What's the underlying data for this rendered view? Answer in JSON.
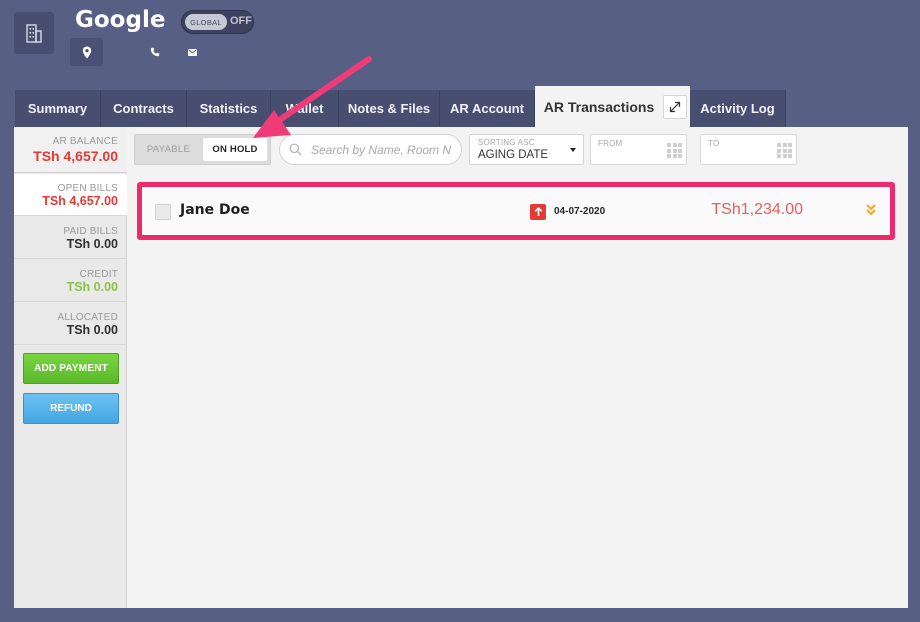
{
  "header": {
    "company_name": "Google",
    "global_toggle": {
      "label": "GLOBAL",
      "state": "OFF"
    }
  },
  "tabs": [
    {
      "label": "Summary"
    },
    {
      "label": "Contracts"
    },
    {
      "label": "Statistics"
    },
    {
      "label": "Wallet"
    },
    {
      "label": "Notes & Files"
    },
    {
      "label": "AR Account"
    },
    {
      "label": "AR Transactions",
      "active": true
    },
    {
      "label": "Activity Log"
    }
  ],
  "sidebar": {
    "ar_balance": {
      "label": "AR BALANCE",
      "value": "TSh 4,657.00"
    },
    "open_bills": {
      "label": "OPEN BILLS",
      "value": "TSh 4,657.00"
    },
    "paid_bills": {
      "label": "PAID BILLS",
      "value": "TSh 0.00"
    },
    "credit": {
      "label": "CREDIT",
      "value": "TSh 0.00"
    },
    "allocated": {
      "label": "ALLOCATED",
      "value": "TSh 0.00"
    },
    "add_payment_label": "ADD PAYMENT",
    "refund_label": "REFUND"
  },
  "filters": {
    "payable_label": "PAYABLE",
    "on_hold_label": "ON HOLD",
    "selected": "ON HOLD",
    "search_placeholder": "Search by Name, Room No",
    "sorting_label": "SORTING ASC",
    "sorting_value": "AGING DATE",
    "from_label": "FROM",
    "to_label": "TO"
  },
  "transactions": [
    {
      "name": "Jane Doe",
      "date": "04-07-2020",
      "amount": "TSh1,234.00",
      "direction": "up"
    }
  ],
  "colors": {
    "background": "#575f84",
    "tab_bg": "#474e70",
    "red": "#e53935",
    "green": "#8bc34a",
    "highlight": "#ee2a6e"
  }
}
